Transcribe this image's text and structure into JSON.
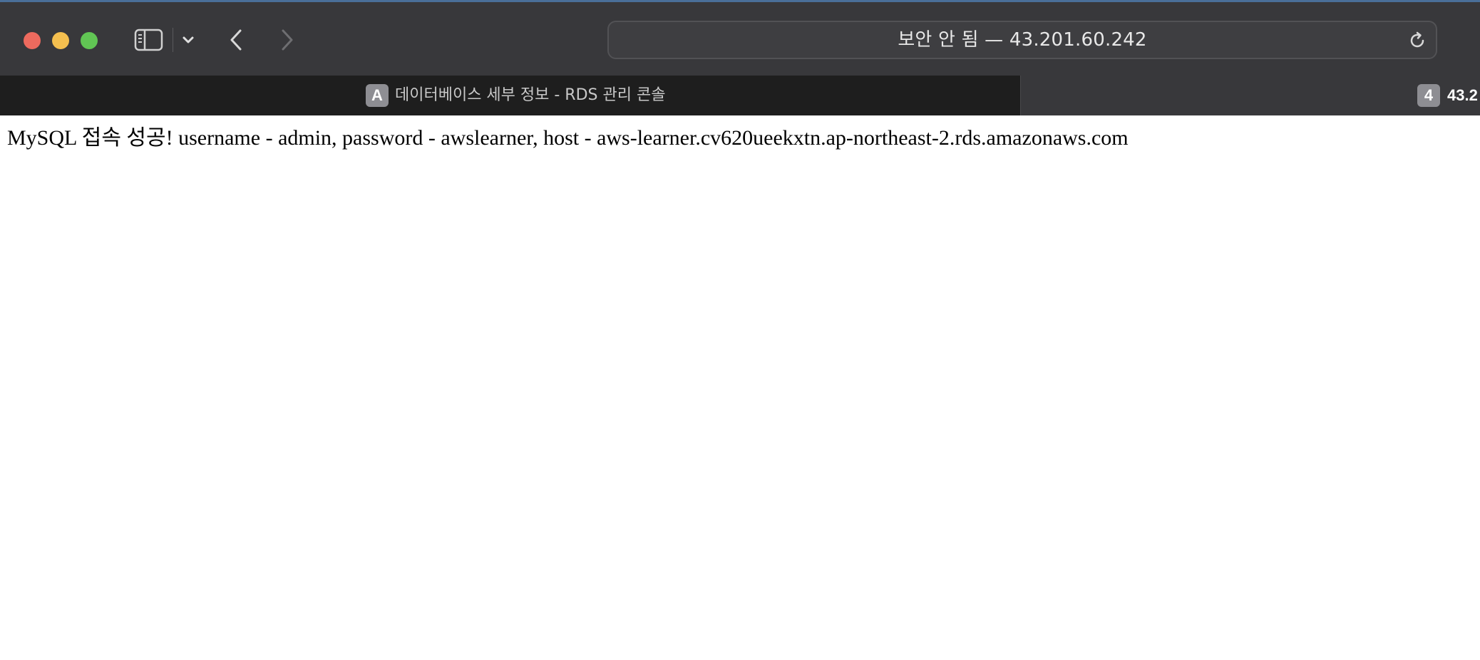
{
  "window": {
    "traffic_lights": {
      "close_color": "#ed6a5e",
      "minimize_color": "#f4bf4f",
      "zoom_color": "#61c554"
    }
  },
  "toolbar": {
    "sidebar_icon": "sidebar-icon",
    "tab_overview_icon": "chevron-down-icon",
    "back_icon": "chevron-left-icon",
    "forward_icon": "chevron-right-icon",
    "address_text": "보안 안 됨 — 43.201.60.242",
    "reload_icon": "reload-icon"
  },
  "tabs": [
    {
      "favicon_letter": "A",
      "title": "데이터베이스 세부 정보 - RDS 관리 콘솔",
      "active": true
    },
    {
      "favicon_letter": "4",
      "title": "43.2",
      "active": false
    }
  ],
  "page": {
    "message": "MySQL 접속 성공! username - admin, password - awslearner, host - aws-learner.cv620ueekxtn.ap-northeast-2.rds.amazonaws.com"
  }
}
